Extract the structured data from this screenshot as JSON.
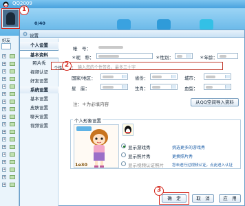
{
  "app": {
    "title": "QQ2009",
    "status_num": "0/40"
  },
  "dialog": {
    "title": "设置",
    "personal_show_group": "个人形象设置"
  },
  "sidebar": {
    "personal_header": "个人设置",
    "system_header": "系统设置",
    "personal_items": [
      {
        "label": "基本资料",
        "active": true
      },
      {
        "label": "照片秀"
      },
      {
        "label": "视频认证"
      },
      {
        "label": "好友设置"
      }
    ],
    "system_items": [
      {
        "label": "基本设置"
      },
      {
        "label": "皮肤设置"
      },
      {
        "label": "聊天设置"
      },
      {
        "label": "视频设置"
      }
    ]
  },
  "form": {
    "account_label": "帐　号：",
    "nickname_label": "＊昵　称：",
    "gender_label": "＊性别：",
    "age_label": "＊年龄：",
    "signature_label": "个性签名：",
    "signature_placeholder": "输入您的个性签名，最多三十字",
    "country_label": "国家/地区：",
    "province_label": "省份：",
    "city_label": "城市：",
    "zodiac_label": "星　座：",
    "animal_label": "生肖：",
    "blood_label": "血型：",
    "note": "注：＊为必填内容",
    "import_button": "从QQ空间导入资料"
  },
  "show": {
    "radio_show": "显示游戏秀",
    "radio_photo": "显示照片秀",
    "radio_video": "显示视频认证照片",
    "link_show": "挑选更多的游戏秀",
    "link_photo": "更换照片秀",
    "link_video": "您未进行过视频认证，点此进入认证",
    "badge": "1e30"
  },
  "buttons": {
    "ok": "确　定",
    "cancel": "取　消",
    "apply": "应　用"
  },
  "markers": {
    "m1": "1",
    "m2": "2",
    "m3": "3"
  },
  "colors": {
    "accent": "#d4271c",
    "title_blue": "#48a2de"
  },
  "left_panel": {
    "tab_label": "好友"
  }
}
